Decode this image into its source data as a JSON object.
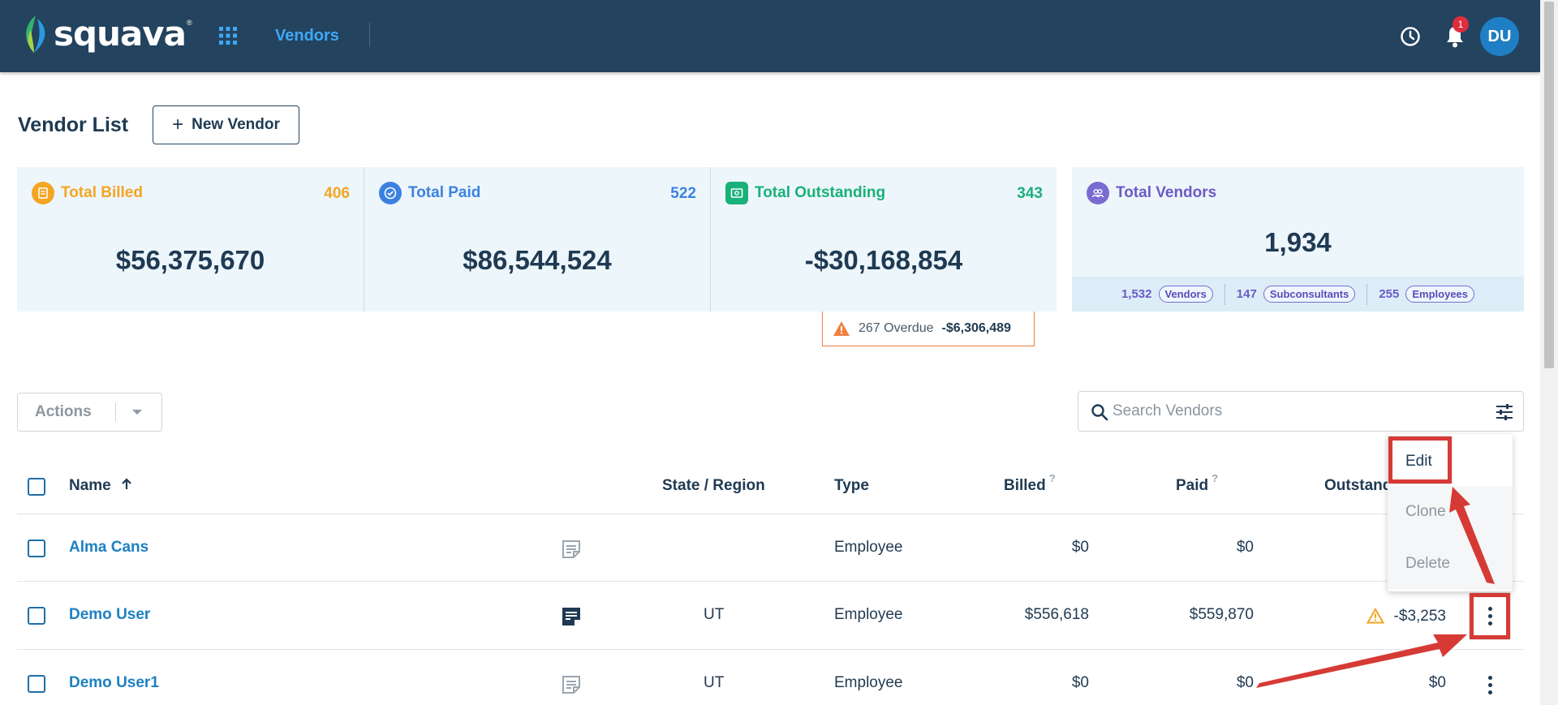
{
  "app": {
    "logo_text": "squava",
    "logo_mark": "®",
    "nav_active": "Vendors"
  },
  "topbar": {
    "notification_count": "1",
    "avatar_initials": "DU"
  },
  "header": {
    "title": "Vendor List",
    "new_vendor_label": "New Vendor"
  },
  "cards": {
    "billed": {
      "label": "Total Billed",
      "count": "406",
      "amount": "$56,375,670",
      "color": "#f3a523"
    },
    "paid": {
      "label": "Total Paid",
      "count": "522",
      "amount": "$86,544,524",
      "color": "#3b82e0"
    },
    "outstanding": {
      "label": "Total Outstanding",
      "count": "343",
      "amount": "-$30,168,854",
      "color": "#19b07a"
    },
    "overdue": {
      "count_label": "267 Overdue",
      "amount": "-$6,306,489"
    },
    "vendors": {
      "label": "Total Vendors",
      "total": "1,934",
      "color": "#6b5bc6",
      "breakdown": [
        {
          "count": "1,532",
          "label": "Vendors"
        },
        {
          "count": "147",
          "label": "Subconsultants"
        },
        {
          "count": "255",
          "label": "Employees"
        }
      ]
    }
  },
  "toolbar": {
    "actions_label": "Actions",
    "search_placeholder": "Search Vendors"
  },
  "table": {
    "columns": {
      "name": "Name",
      "state": "State / Region",
      "type": "Type",
      "billed": "Billed",
      "paid": "Paid",
      "outstanding": "Outstand",
      "help": "?"
    },
    "rows": [
      {
        "name": "Alma Cans",
        "state": "",
        "type": "Employee",
        "billed": "$0",
        "paid": "$0",
        "outstanding": ""
      },
      {
        "name": "Demo User",
        "state": "UT",
        "type": "Employee",
        "billed": "$556,618",
        "paid": "$559,870",
        "outstanding": "-$3,253"
      },
      {
        "name": "Demo User1",
        "state": "UT",
        "type": "Employee",
        "billed": "$0",
        "paid": "$0",
        "outstanding": "$0"
      }
    ]
  },
  "row_menu": {
    "edit": "Edit",
    "clone": "Clone",
    "delete": "Delete"
  }
}
